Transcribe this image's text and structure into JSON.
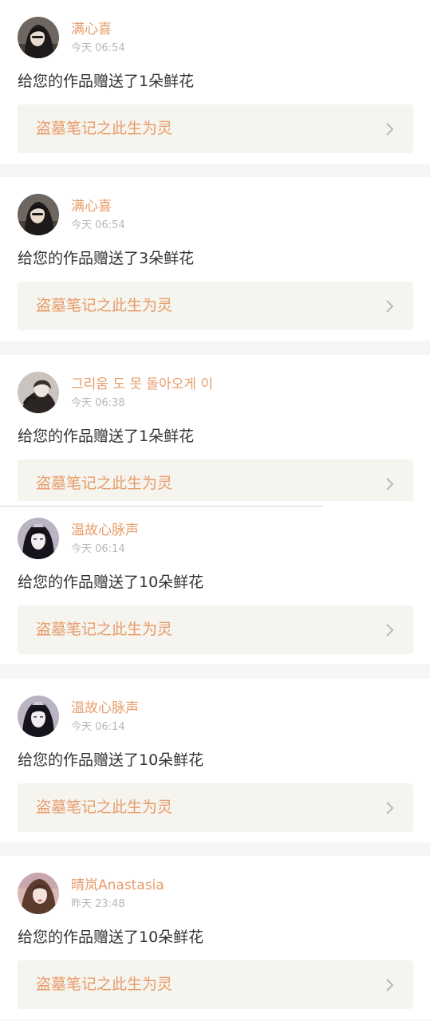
{
  "colors": {
    "accent": "#e79c6a",
    "text": "#333333",
    "muted": "#b8b8b8",
    "card_link_bg": "#f5f4ee",
    "page_bg": "#f6f6f6"
  },
  "notifications": [
    {
      "username": "满心喜",
      "time": "今天 06:54",
      "message": "给您的作品赠送了1朵鲜花",
      "work_title": "盗墓笔记之此生为灵",
      "chevron_icon": "chevron-right-icon"
    },
    {
      "username": "满心喜",
      "time": "今天 06:54",
      "message": "给您的作品赠送了3朵鲜花",
      "work_title": "盗墓笔记之此生为灵",
      "chevron_icon": "chevron-right-icon"
    },
    {
      "username": "그리움 도 못 돌아오게 이",
      "time": "今天 06:38",
      "message": "给您的作品赠送了1朵鲜花",
      "work_title": "盗墓笔记之此生为灵",
      "chevron_icon": "chevron-right-icon"
    },
    {
      "username": "温故心脉声",
      "time": "今天 06:14",
      "message": "给您的作品赠送了10朵鲜花",
      "work_title": "盗墓笔记之此生为灵",
      "chevron_icon": "chevron-right-icon"
    },
    {
      "username": "温故心脉声",
      "time": "今天 06:14",
      "message": "给您的作品赠送了10朵鲜花",
      "work_title": "盗墓笔记之此生为灵",
      "chevron_icon": "chevron-right-icon"
    },
    {
      "username": "晴岚Anastasia",
      "time": "昨天 23:48",
      "message": "给您的作品赠送了10朵鲜花",
      "work_title": "盗墓笔记之此生为灵",
      "chevron_icon": "chevron-right-icon"
    }
  ]
}
